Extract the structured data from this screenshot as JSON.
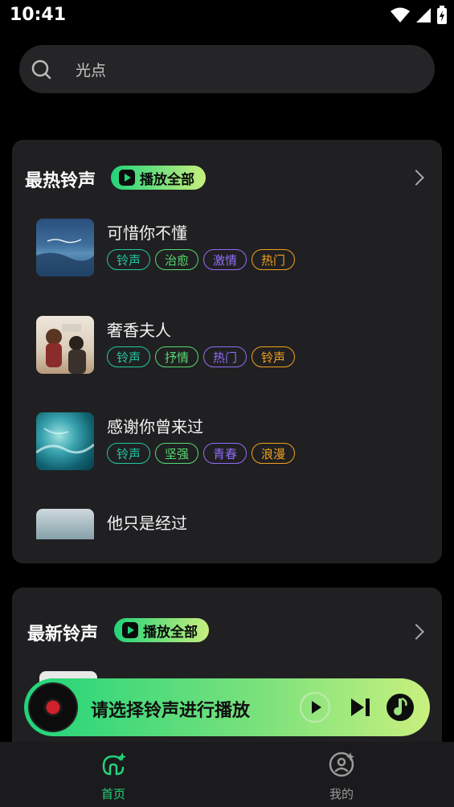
{
  "status_bar": {
    "time": "10:41"
  },
  "search": {
    "placeholder": "光点"
  },
  "hot_section": {
    "title": "最热铃声",
    "play_all_label": "播放全部",
    "songs": [
      {
        "title": "可惜你不懂",
        "tags": [
          "铃声",
          "治愈",
          "激情",
          "热门"
        ]
      },
      {
        "title": "奢香夫人",
        "tags": [
          "铃声",
          "抒情",
          "热门",
          "铃声"
        ]
      },
      {
        "title": "感谢你曾来过",
        "tags": [
          "铃声",
          "坚强",
          "青春",
          "浪漫"
        ]
      },
      {
        "title": "他只是经过",
        "tags": []
      }
    ]
  },
  "new_section": {
    "title": "最新铃声",
    "play_all_label": "播放全部"
  },
  "player": {
    "prompt": "请选择铃声进行播放"
  },
  "bottom_nav": {
    "home_label": "首页",
    "mine_label": "我的"
  },
  "colors": {
    "tag_teal": "#22c7a0",
    "tag_green": "#57d96f",
    "tag_purple": "#8f6ef7",
    "tag_orange": "#f0a020",
    "accent_green": "#22d37a"
  }
}
